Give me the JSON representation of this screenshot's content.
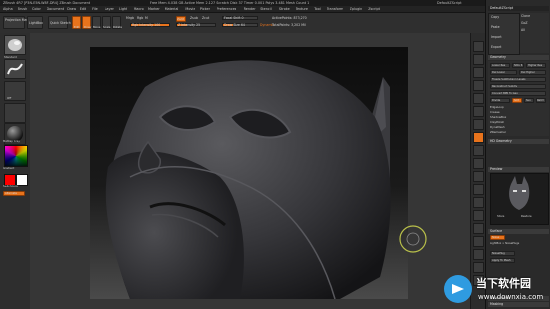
{
  "titlebar": {
    "left_text": "ZBrush 4R7 [P3N-E5N-W8F-DR4] ZBrush Document",
    "mid_text": "Free Mem 4.038 GB  Active Mem 2.127  Scratch Disk 37  Timer 0.001  Polys 3.481  Mesh Count 1",
    "right_text": "DefaultZScript"
  },
  "menubar": {
    "items": [
      "Alpha",
      "Brush",
      "Color",
      "Document",
      "Draw",
      "Edit",
      "File",
      "Layer",
      "Light",
      "Macro",
      "Marker",
      "Material",
      "Movie",
      "Picker",
      "Preferences",
      "Render",
      "Stencil",
      "Stroke",
      "Texture",
      "Tool",
      "Transform",
      "Zplugin",
      "Zscript"
    ]
  },
  "shelf": {
    "lightbox": "LightBox",
    "projection_master": "Projection Master",
    "quicksketch": "Quick Sketch",
    "edit": "Edit",
    "draw": "Draw",
    "move": "Move",
    "scale": "Scale",
    "rotate": "Rotate",
    "mrgb": "Mrgb",
    "rgb": "Rgb",
    "m": "M",
    "zadd": "Zadd",
    "zsub": "Zsub",
    "zcut": "Zcut",
    "rgb_intensity": "Rgb Intensity 100",
    "rgb_intensity_value": 1.0,
    "z_intensity": "Z Intensity 25",
    "z_intensity_value": 0.25,
    "focal_shift": "Focal Shift 0",
    "draw_size": "Draw Size 64",
    "dynamic": "Dynamic",
    "active_points": "ActivePoints: 873,270",
    "total_points": "TotalPoints: 3,202 Mil"
  },
  "lefttray": {
    "brush_label": "Standard",
    "alpha_label": "Off",
    "material_label": "MatCap Gray",
    "gradient": "Gradient",
    "switch_color": "SwitchColor",
    "alternate": "Alternate",
    "color_main": "#ff0000",
    "color_secondary": "#ffffff"
  },
  "righttools": {
    "items": [
      "bpr-icon",
      "spix-icon",
      "scroll-icon",
      "zoom-icon",
      "actual-icon",
      "aahalf-icon",
      "persp-icon",
      "floor-icon",
      "local-icon",
      "xyz-icon",
      "frame-icon",
      "move-icon",
      "scale-icon",
      "rotate-icon",
      "polyf-icon",
      "transp-icon",
      "ghost-icon",
      "solo-icon",
      "xpose-icon"
    ]
  },
  "rightpanel": {
    "top_buttons": [
      "Copy",
      "Paste",
      "Import",
      "Export"
    ],
    "list_items": [
      "Subtool",
      "Geometry",
      "HD Geometry",
      "Preview",
      "Surface",
      "Deformation",
      "Masking",
      "Visibility",
      "Polygroups",
      "Contact",
      "Morph Target",
      "Polypaint",
      "UV Map",
      "Texture Map",
      "Displacement Map",
      "Normal Map"
    ],
    "clone_label": "Clone",
    "make_polymesh": "Make PolyMesh3D",
    "goz": "GoZ",
    "all": "All",
    "visible": "Visible",
    "r": "R",
    "lightbox_tools": "Lightbox > Tools",
    "tool_name": "PM3D_Batman",
    "geometry_header": "Geometry",
    "lower_res": "Lower Res",
    "higher_res": "Higher Res",
    "sdiv": "SDiv 6",
    "del_lower": "Del Lower",
    "del_higher": "Del Higher",
    "freeze": "Freeze SubDivision Levels",
    "reconstruct": "Reconstruct Subdiv",
    "convert_bpr": "Convert BPR To Geo",
    "divide": "Divide",
    "smt": "Smt",
    "suv": "Suv",
    "reuv": "ReUV",
    "edge_loop": "EdgeLoop",
    "crease": "Crease",
    "shadowbox": "ShadowBox",
    "clay_polish": "ClayPolish",
    "dynamesh": "DynaMesh",
    "zremesher": "ZRemesher",
    "modify_topology": "Modify Topology",
    "position": "Position",
    "size": "Size",
    "mesh_integrity": "MeshIntegrity",
    "hd_geometry": "HD Geometry",
    "preview_header": "Preview",
    "store": "Store",
    "restore": "Restore",
    "surface_header": "Surface",
    "noise": "Noise",
    "lightbox_noise": "LightBox > NoisePlugs",
    "noise_plug": "NoisePlug",
    "apply_to_mesh": "Apply To Mesh",
    "deformation": "Deformation",
    "masking": "Masking",
    "visibility": "Visibility"
  },
  "watermark": {
    "title": "当下软件园",
    "url": "www.downxia.com"
  }
}
